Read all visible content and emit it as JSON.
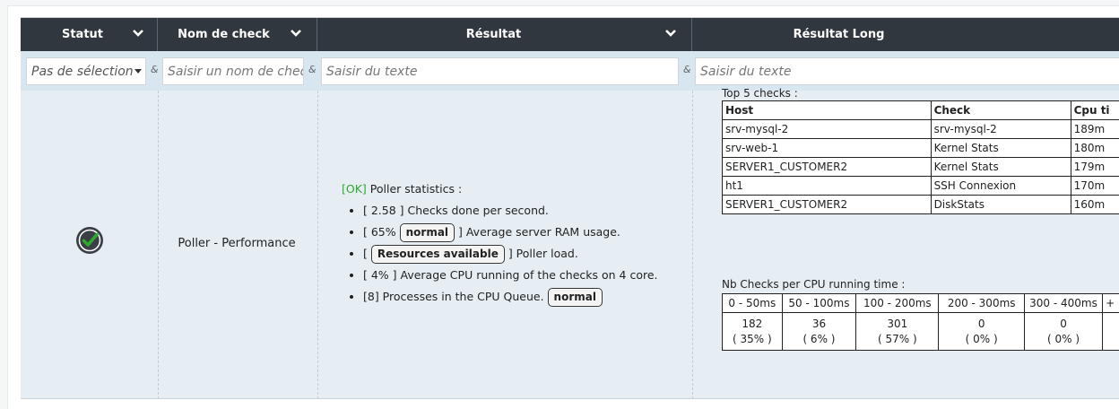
{
  "header": {
    "col_status": "Statut",
    "col_check_name": "Nom de check",
    "col_result": "Résultat",
    "col_long_result": "Résultat Long"
  },
  "filters": {
    "status_select": "Pas de sélection",
    "ampersand": "&",
    "check_name_placeholder": "Saisir un nom de check",
    "result_placeholder": "Saisir du texte",
    "long_result_placeholder": "Saisir du texte"
  },
  "row": {
    "status_icon": "check-circle-icon",
    "check_name": "Poller - Performance",
    "result": {
      "ok_tag": "[OK]",
      "title": "Poller statistics :",
      "items": [
        {
          "pre": "[ 2.58 ] Checks done per second.",
          "btn": "",
          "post": ""
        },
        {
          "pre": "[ 65% ",
          "btn": "normal",
          "post": " ] Average server RAM usage."
        },
        {
          "pre": "[ ",
          "btn": "Resources available",
          "post": " ] Poller load."
        },
        {
          "pre": "[ 4% ] Average CPU running of the checks on 4 core.",
          "btn": "",
          "post": ""
        },
        {
          "pre": "[8] Processes in the CPU Queue. ",
          "btn": "normal",
          "post": ""
        }
      ]
    },
    "long_result": {
      "top5_title": "Top 5 checks :",
      "top5_headers": [
        "Host",
        "Check",
        "Cpu ti"
      ],
      "top5_rows": [
        [
          "srv-mysql-2",
          "srv-mysql-2",
          "189m"
        ],
        [
          "srv-web-1",
          "Kernel Stats",
          "180m"
        ],
        [
          "SERVER1_CUSTOMER2",
          "Kernel Stats",
          "179m"
        ],
        [
          "ht1",
          "SSH Connexion",
          "170m"
        ],
        [
          "SERVER1_CUSTOMER2",
          "DiskStats",
          "160m"
        ]
      ],
      "nb_title": "Nb Checks per CPU running time :",
      "nb_headers": [
        "0 - 50ms",
        "50 - 100ms",
        "100 - 200ms",
        "200 - 300ms",
        "300 - 400ms",
        "+"
      ],
      "nb_counts": [
        "182",
        "36",
        "301",
        "0",
        "0",
        ""
      ],
      "nb_percents": [
        "( 35% )",
        "( 6% )",
        "( 57% )",
        "( 0% )",
        "( 0% )",
        ""
      ]
    }
  },
  "colors": {
    "header_bg": "#30373e",
    "filter_bg": "#d8e6ef",
    "row_bg": "#e6eef4",
    "ok_green": "#2ea82e"
  }
}
